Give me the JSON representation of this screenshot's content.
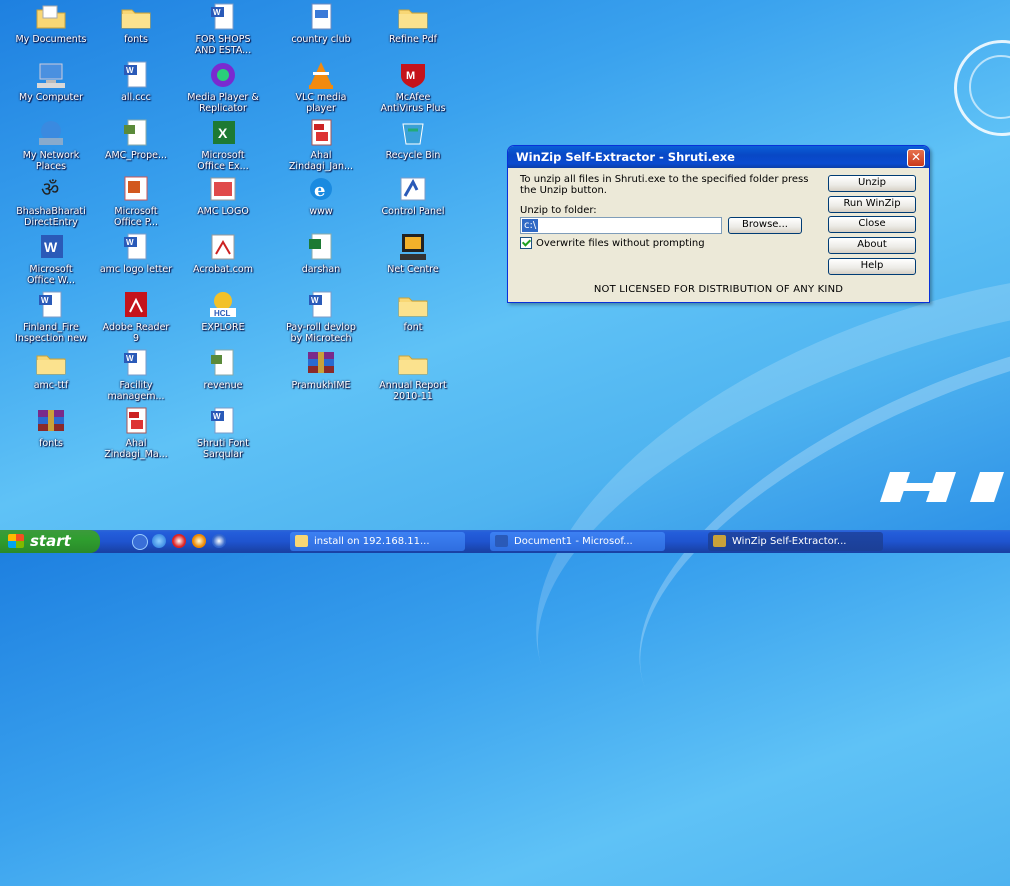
{
  "desktop": {
    "icons": [
      {
        "label": "My Documents",
        "icon": "my-documents-icon"
      },
      {
        "label": "fonts",
        "icon": "folder-icon"
      },
      {
        "label": "FOR SHOPS\nAND ESTA...",
        "icon": "word-document-icon"
      },
      {
        "label": "country club",
        "icon": "publisher-document-icon"
      },
      {
        "label": "Refine Pdf",
        "icon": "folder-icon"
      },
      {
        "label": "My Computer",
        "icon": "my-computer-icon"
      },
      {
        "label": "all.ccc",
        "icon": "word-document-icon"
      },
      {
        "label": "Media Player &\nReplicator",
        "icon": "media-player-icon"
      },
      {
        "label": "VLC media\nplayer",
        "icon": "vlc-icon"
      },
      {
        "label": "McAfee\nAntiVirus Plus",
        "icon": "mcafee-icon"
      },
      {
        "label": "My Network\nPlaces",
        "icon": "network-places-icon"
      },
      {
        "label": "AMC_Prope...",
        "icon": "document-icon"
      },
      {
        "label": "Microsoft\nOffice Ex...",
        "icon": "excel-icon"
      },
      {
        "label": "Ahal\nZindagi_Jan...",
        "icon": "pdf-document-icon"
      },
      {
        "label": "Recycle Bin",
        "icon": "recycle-bin-icon"
      },
      {
        "label": "BhashaBharati\nDirectEntry",
        "icon": "om-symbol-icon"
      },
      {
        "label": "Microsoft\nOffice P...",
        "icon": "powerpoint-icon"
      },
      {
        "label": "AMC LOGO",
        "icon": "image-icon"
      },
      {
        "label": "www",
        "icon": "internet-explorer-icon"
      },
      {
        "label": "Control Panel",
        "icon": "control-panel-icon"
      },
      {
        "label": "Microsoft\nOffice W...",
        "icon": "word-icon"
      },
      {
        "label": "amc logo letter",
        "icon": "word-document-icon"
      },
      {
        "label": "Acrobat.com",
        "icon": "acrobat-icon"
      },
      {
        "label": "darshan",
        "icon": "spreadsheet-icon"
      },
      {
        "label": "Net Centre",
        "icon": "computer-monitor-icon"
      },
      {
        "label": "Finland_Fire\nInspection new",
        "icon": "word-document-icon"
      },
      {
        "label": "Adobe Reader\n9",
        "icon": "adobe-reader-icon"
      },
      {
        "label": "EXPLORE",
        "icon": "hcl-explore-icon"
      },
      {
        "label": "Pay-roll devlop\nby Microtech",
        "icon": "word-document-icon"
      },
      {
        "label": "font",
        "icon": "folder-icon"
      },
      {
        "label": "amc-ttf",
        "icon": "folder-icon"
      },
      {
        "label": "Facility\nmanagem...",
        "icon": "word-document-icon"
      },
      {
        "label": "revenue",
        "icon": "document-icon"
      },
      {
        "label": "PramukhIME",
        "icon": "winrar-icon"
      },
      {
        "label": "Annual Report\n2010-11",
        "icon": "folder-icon"
      },
      {
        "label": "fonts",
        "icon": "winrar-icon"
      },
      {
        "label": "Ahal\nZindagi_Ma...",
        "icon": "pdf-document-icon"
      },
      {
        "label": "Shruti Font\nSarqular",
        "icon": "word-document-icon"
      }
    ]
  },
  "dialog": {
    "title": "WinZip Self-Extractor - Shruti.exe",
    "message": "To unzip all files in Shruti.exe to the specified folder press the Unzip button.",
    "folder_label": "Unzip to folder:",
    "folder_value": "c:\\",
    "browse_label": "Browse...",
    "overwrite_label": "Overwrite files without prompting",
    "overwrite_checked": true,
    "buttons": {
      "unzip": "Unzip",
      "run_winzip": "Run WinZip",
      "close": "Close",
      "about": "About",
      "help": "Help"
    },
    "license_text": "NOT LICENSED FOR DISTRIBUTION OF ANY KIND"
  },
  "taskbar": {
    "start_label": "start",
    "tasks": [
      {
        "label": "install on 192.168.11...",
        "icon": "folder-icon",
        "active": false
      },
      {
        "label": "Document1 - Microsof...",
        "icon": "word-icon",
        "active": false
      },
      {
        "label": "WinZip Self-Extractor...",
        "icon": "winzip-icon",
        "active": true
      }
    ]
  },
  "colors": {
    "desktop_bg": "#3aa2ee",
    "titlebar": "#0848c5",
    "taskbar": "#245edb",
    "start_button": "#2f9e2f"
  }
}
